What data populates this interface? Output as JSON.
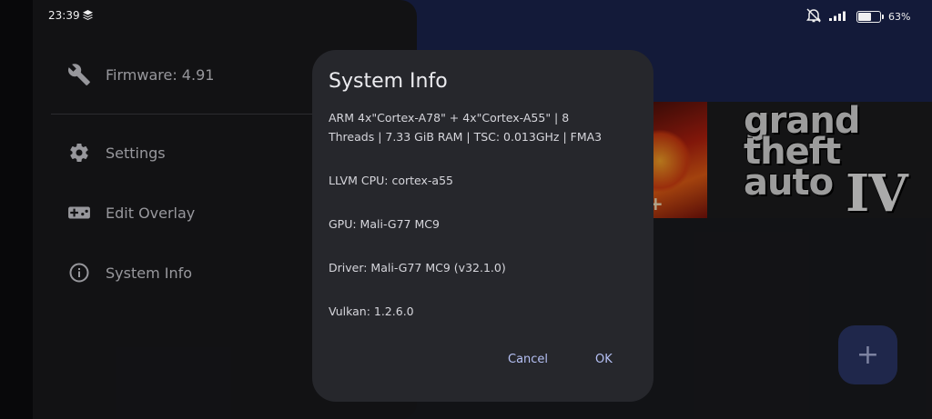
{
  "status_bar": {
    "time": "23:39",
    "battery_level": "63",
    "battery_fraction": 0.63,
    "icons": [
      "stack-icon",
      "mute-icon",
      "signal-icon",
      "battery-icon"
    ]
  },
  "drawer": {
    "firmware_label": "Firmware: 4.91",
    "items": [
      {
        "label": "Settings",
        "icon": "gear-icon"
      },
      {
        "label": "Edit Overlay",
        "icon": "gamepad-icon"
      },
      {
        "label": "System Info",
        "icon": "info-icon"
      }
    ]
  },
  "games": {
    "tile_a_badge": "+",
    "tile_b_lines": [
      "grand",
      "theft",
      "auto"
    ],
    "tile_b_numeral": "IV"
  },
  "fab": {
    "label": "+"
  },
  "dialog": {
    "title": "System Info",
    "cpu_line_1": "ARM 4x\"Cortex-A78\" + 4x\"Cortex-A55\" | 8",
    "cpu_line_2": "Threads | 7.33 GiB RAM | TSC: 0.013GHz | FMA3",
    "llvm": "LLVM CPU: cortex-a55",
    "gpu": "GPU: Mali-G77 MC9",
    "driver": "Driver: Mali-G77 MC9 (v32.1.0)",
    "vulkan": "Vulkan: 1.2.6.0",
    "cancel_label": "Cancel",
    "ok_label": "OK"
  },
  "colors": {
    "accent": "#b5c0f4",
    "dialog_bg": "#26272c",
    "drawer_bg": "#19191d",
    "app_header": "#1b2450",
    "fab_bg": "#2c3768"
  }
}
